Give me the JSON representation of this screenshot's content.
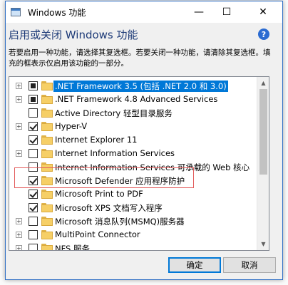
{
  "window": {
    "title": "Windows 功能",
    "minimize_glyph": "—",
    "maximize_glyph": "☐",
    "close_glyph": "✕"
  },
  "heading": "启用或关闭 Windows 功能",
  "help_glyph": "?",
  "description": "若要启用一种功能，请选择其复选框。若要关闭一种功能，请清除其复选框。填充的框表示仅启用该功能的一部分。",
  "features": [
    {
      "label": ".NET Framework 3.5 (包括 .NET 2.0 和 3.0)",
      "expander": "+",
      "state": "partial",
      "selected": true
    },
    {
      "label": ".NET Framework 4.8 Advanced Services",
      "expander": "+",
      "state": "partial",
      "selected": false
    },
    {
      "label": "Active Directory 轻型目录服务",
      "expander": "",
      "state": "unchecked",
      "selected": false
    },
    {
      "label": "Hyper-V",
      "expander": "+",
      "state": "checked",
      "selected": false
    },
    {
      "label": "Internet Explorer 11",
      "expander": "",
      "state": "checked",
      "selected": false
    },
    {
      "label": "Internet Information Services",
      "expander": "+",
      "state": "unchecked",
      "selected": false
    },
    {
      "label": "Internet Information Services 可承载的 Web 核心",
      "expander": "",
      "state": "unchecked",
      "selected": false
    },
    {
      "label": "Microsoft Defender 应用程序防护",
      "expander": "",
      "state": "checked",
      "selected": false
    },
    {
      "label": "Microsoft Print to PDF",
      "expander": "",
      "state": "checked",
      "selected": false
    },
    {
      "label": "Microsoft XPS 文档写入程序",
      "expander": "",
      "state": "checked",
      "selected": false
    },
    {
      "label": "Microsoft 消息队列(MSMQ)服务器",
      "expander": "+",
      "state": "unchecked",
      "selected": false
    },
    {
      "label": "MultiPoint Connector",
      "expander": "+",
      "state": "unchecked",
      "selected": false
    },
    {
      "label": "NFS 服务",
      "expander": "+",
      "state": "unchecked",
      "selected": false
    }
  ],
  "buttons": {
    "ok": "确定",
    "cancel": "取消"
  },
  "colors": {
    "accent": "#0078d7",
    "highlight_box": "#e25a5a",
    "heading": "#1e3b78"
  }
}
